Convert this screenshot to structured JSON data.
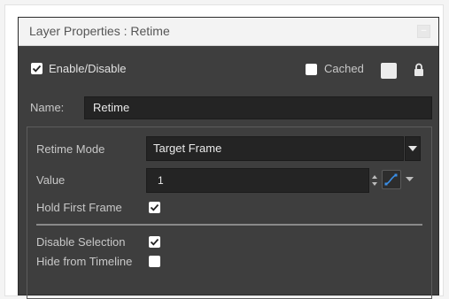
{
  "window": {
    "title": "Layer Properties : Retime",
    "close_glyph": "–"
  },
  "top_row": {
    "enable_label": "Enable/Disable",
    "enable_checked": true,
    "cached_label": "Cached",
    "cached_checked": false,
    "color_swatch": "#ececec",
    "lock_icon": "lock-icon"
  },
  "name_field": {
    "label": "Name:",
    "value": "Retime"
  },
  "retime": {
    "mode_label": "Retime Mode",
    "mode_value": "Target Frame",
    "value_label": "Value",
    "value": "1",
    "hold_first_frame_label": "Hold First Frame",
    "hold_first_frame_checked": true,
    "disable_selection_label": "Disable Selection",
    "disable_selection_checked": true,
    "hide_from_timeline_label": "Hide from Timeline",
    "hide_from_timeline_checked": false
  },
  "colors": {
    "window_bg": "#3e3e3e",
    "field_bg": "#242424",
    "accent_blue": "#3a8ee6"
  }
}
